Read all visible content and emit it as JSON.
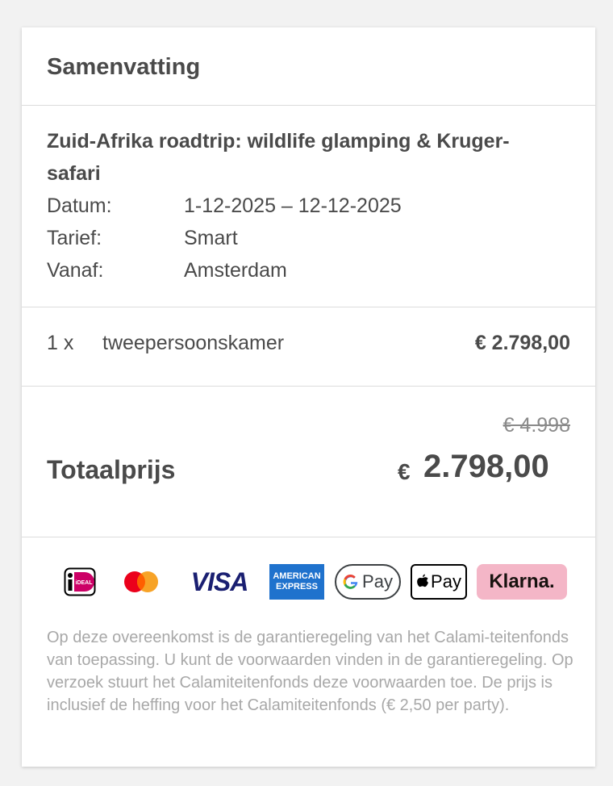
{
  "summary": {
    "title": "Samenvatting",
    "trip_name": "Zuid-Afrika roadtrip: wildlife glamping & Kruger-safari",
    "details": [
      {
        "label": "Datum:",
        "value": "1-12-2025 – 12-12-2025"
      },
      {
        "label": "Tarief:",
        "value": "Smart"
      },
      {
        "label": "Vanaf:",
        "value": "Amsterdam"
      }
    ],
    "room": {
      "qty": "1 x",
      "name": "tweepersoonskamer",
      "price": "€ 2.798,00"
    },
    "old_price": "€ 4.998",
    "total_label": "Totaalprijs",
    "total_currency": "€",
    "total_value": "2.798,00"
  },
  "payment_methods": [
    {
      "icon": "ideal-icon",
      "label": "iDEAL"
    },
    {
      "icon": "mastercard-icon",
      "label": "Mastercard"
    },
    {
      "icon": "visa-icon",
      "label": "VISA"
    },
    {
      "icon": "amex-icon",
      "label": "AMERICAN EXPRESS"
    },
    {
      "icon": "google-pay-icon",
      "label": "Pay"
    },
    {
      "icon": "apple-pay-icon",
      "label": "Pay"
    },
    {
      "icon": "klarna-icon",
      "label": "Klarna."
    }
  ],
  "disclaimer": "Op deze overeenkomst is de garantieregeling van het Calami-teitenfonds van toepassing. U kunt de voorwaarden vinden in de garantieregeling. Op verzoek stuurt het Calamiteitenfonds deze voorwaarden toe. De prijs is inclusief de heffing voor het Calamiteitenfonds (€ 2,50 per party).",
  "colors": {
    "text": "#4a4a4a",
    "muted": "#a8a8a8",
    "klarna_bg": "#f4b6c7",
    "visa_blue": "#1a1f71",
    "amex_blue": "#1f72cd"
  }
}
